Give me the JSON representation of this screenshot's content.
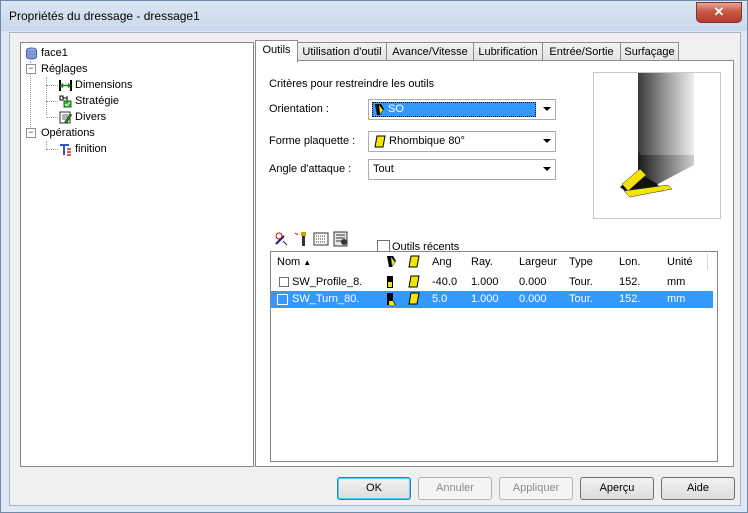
{
  "window": {
    "title": "Propriétés du dressage - dressage1",
    "close_label": "✕"
  },
  "tree": {
    "root": "face1",
    "reglages": "Réglages",
    "dimensions": "Dimensions",
    "strategie": "Stratégie",
    "divers": "Divers",
    "operations": "Opérations",
    "finition": "finition",
    "expand_minus": "−"
  },
  "tabs": [
    "Outils",
    "Utilisation d'outil",
    "Avance/Vitesse",
    "Lubrification",
    "Entrée/Sortie",
    "Surfaçage"
  ],
  "criteria": {
    "heading": "Critères pour restreindre les outils",
    "orientation_label": "Orientation :",
    "orientation_value": "SO",
    "forme_label": "Forme plaquette :",
    "forme_value": "Rhombique 80°",
    "angle_label": "Angle d'attaque :",
    "angle_value": "Tout"
  },
  "recent_tools_label": "Outils récents",
  "table": {
    "columns": [
      "Nom",
      "",
      "",
      "Ang",
      "Ray.",
      "Largeur",
      "Type",
      "Lon.",
      "Unité"
    ],
    "rows": [
      {
        "name": "SW_Profile_8.",
        "ang": "-40.0",
        "ray": "1.000",
        "largeur": "0.000",
        "type": "Tour.",
        "lon": "152.",
        "unite": "mm"
      },
      {
        "name": "SW_Turn_80.",
        "ang": "5.0",
        "ray": "1.000",
        "largeur": "0.000",
        "type": "Tour.",
        "lon": "152.",
        "unite": "mm"
      }
    ]
  },
  "buttons": {
    "ok": "OK",
    "annuler": "Annuler",
    "appliquer": "Appliquer",
    "apercu": "Aperçu",
    "aide": "Aide"
  },
  "colors": {
    "selection": "#3399ff",
    "insert_yellow": "#f2e600",
    "titlebar": "#c8d8ec"
  }
}
